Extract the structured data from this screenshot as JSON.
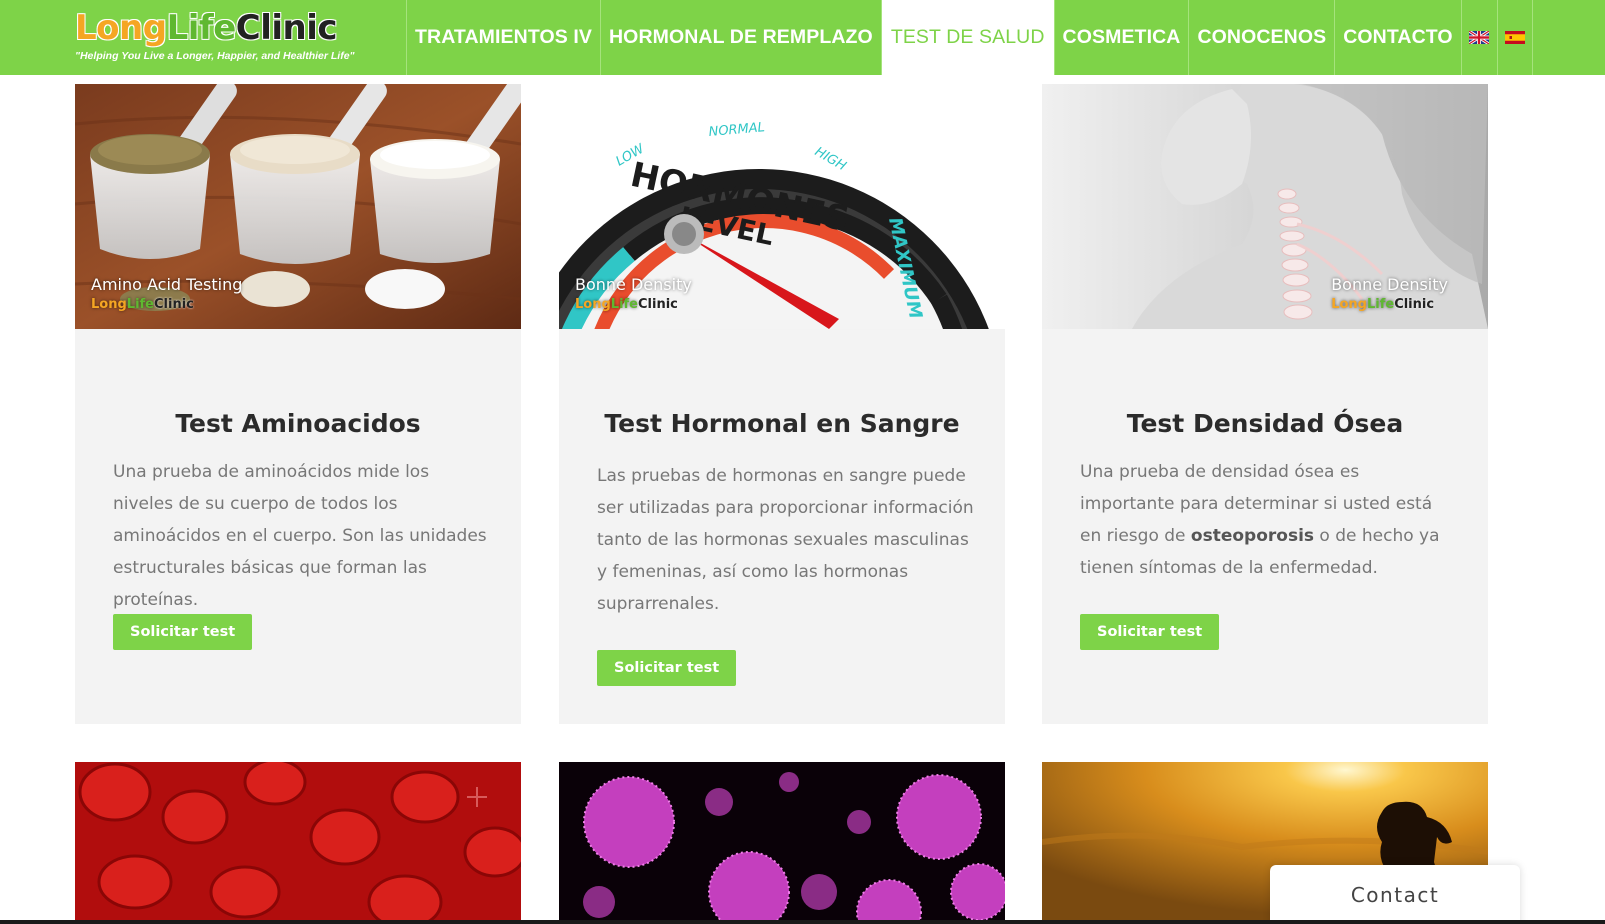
{
  "brand": {
    "logo_part1": "Long",
    "logo_part2": "Life",
    "logo_part3": "Clinic",
    "tagline": "\"Helping You Live a Longer, Happier, and Healthier Life\""
  },
  "nav": {
    "items": [
      {
        "label": "TRATAMIENTOS IV"
      },
      {
        "label": "HORMONAL DE REMPLAZO"
      },
      {
        "label": "TEST DE SALUD",
        "active": true
      },
      {
        "label": "COSMETICA"
      },
      {
        "label": "CONOCENOS"
      },
      {
        "label": "CONTACTO"
      }
    ],
    "flags": [
      {
        "icon": "uk-flag-icon",
        "language": "English"
      },
      {
        "icon": "spain-flag-icon",
        "language": "Español"
      }
    ]
  },
  "cards": [
    {
      "title": "Test Aminoacidos",
      "text": "Una prueba de aminoácidos mide los niveles de su cuerpo de todos los aminoácidos en el cuerpo. Son las unidades estructurales básicas que forman las proteínas.",
      "button": "Solicitar test",
      "image_caption": "Amino Acid Testing",
      "image_brand": [
        "Long",
        "Life",
        "Clinic"
      ]
    },
    {
      "title": "Test Hormonal en Sangre",
      "text": "Las pruebas de hormonas en sangre puede ser utilizadas para proporcionar información tanto de las hormonas sexuales masculinas y femeninas, así como las hormonas suprarrenales.",
      "button": "Solicitar test",
      "image_caption": "Bonne Density",
      "image_brand": [
        "Long",
        "Life",
        "Clinic"
      ],
      "gauge": {
        "title_line1": "HORMONES",
        "title_line2": "LEVEL",
        "scale_labels": [
          "LOW",
          "NORMAL",
          "HIGH",
          "MAXIMUM"
        ]
      }
    },
    {
      "title": "Test Densidad Ósea",
      "text_before": "Una prueba de densidad ósea es importante para determinar si usted está en riesgo de ",
      "text_bold": "osteoporosis",
      "text_after": " o de hecho ya tienen síntomas de la enfermedad.",
      "button": "Solicitar test",
      "image_caption": "Bonne Density",
      "image_brand": [
        "Long",
        "Life",
        "Clinic"
      ]
    }
  ],
  "contact_widget": {
    "label": "Contact"
  },
  "colors": {
    "brand_green": "#7ed348",
    "brand_orange": "#f5a623",
    "card_bg": "#f3f3f3"
  }
}
